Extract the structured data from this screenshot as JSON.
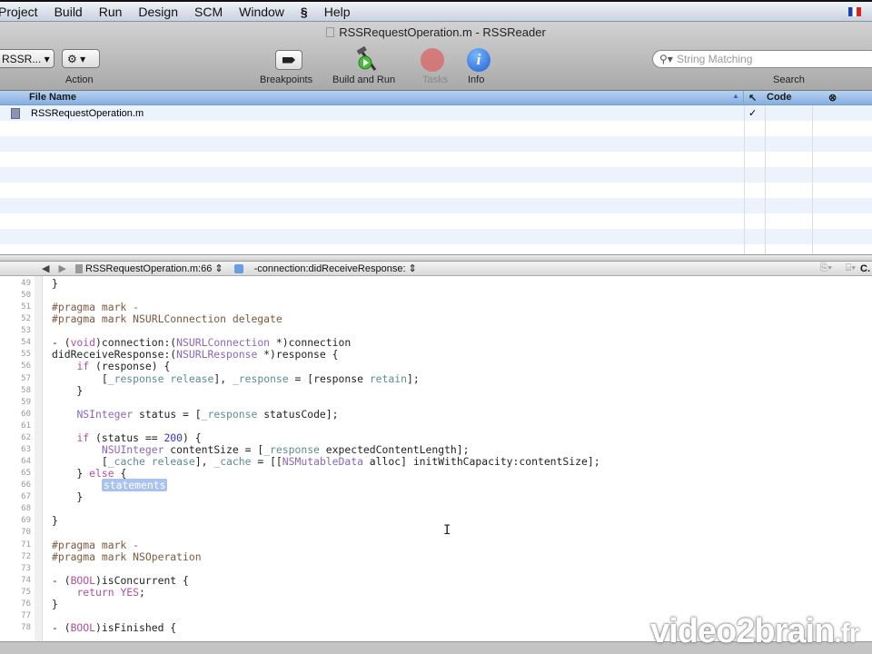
{
  "menu": [
    "Project",
    "Build",
    "Run",
    "Design",
    "SCM",
    "Window",
    "Help"
  ],
  "window_title": "RSSRequestOperation.m - RSSReader",
  "toolbar": {
    "overview_popup": "RSSR...",
    "action_label": "Action",
    "breakpoints_label": "Breakpoints",
    "build_run_label": "Build and Run",
    "tasks_label": "Tasks",
    "info_label": "Info",
    "search_placeholder": "String Matching",
    "search_label": "Search"
  },
  "file_list": {
    "headers": {
      "name": "File Name",
      "code": "Code"
    },
    "rows": [
      {
        "name": "RSSRequestOperation.m",
        "check": "✓"
      }
    ]
  },
  "editor_nav": {
    "file": "RSSRequestOperation.m:66",
    "function": "-connection:didReceiveResponse:"
  },
  "code": {
    "first_line": 49,
    "lines": [
      [
        [
          "}",
          ""
        ]
      ],
      [],
      [
        [
          "#pragma mark -",
          "pp"
        ]
      ],
      [
        [
          "#pragma mark NSURLConnection delegate",
          "pp"
        ]
      ],
      [],
      [
        [
          "- (",
          ""
        ],
        [
          "void",
          "kw"
        ],
        [
          ")connection:(",
          ""
        ],
        [
          "NSURLConnection",
          "ty"
        ],
        [
          " *)connection",
          ""
        ]
      ],
      [
        [
          "didReceiveResponse:(",
          ""
        ],
        [
          "NSURLResponse",
          "ty"
        ],
        [
          " *)response {",
          ""
        ]
      ],
      [
        [
          "    ",
          ""
        ],
        [
          "if",
          "kw"
        ],
        [
          " (response) {",
          ""
        ]
      ],
      [
        [
          "        [",
          ""
        ],
        [
          "_response",
          "iv"
        ],
        [
          " ",
          ""
        ],
        [
          "release",
          "iv"
        ],
        [
          "], ",
          ""
        ],
        [
          "_response",
          "iv"
        ],
        [
          " = [response ",
          ""
        ],
        [
          "retain",
          "iv"
        ],
        [
          "];",
          ""
        ]
      ],
      [
        [
          "    }",
          ""
        ]
      ],
      [],
      [
        [
          "    ",
          ""
        ],
        [
          "NSInteger",
          "ty"
        ],
        [
          " status = [",
          ""
        ],
        [
          "_response",
          "iv"
        ],
        [
          " statusCode];",
          ""
        ]
      ],
      [],
      [
        [
          "    ",
          ""
        ],
        [
          "if",
          "kw"
        ],
        [
          " (status == ",
          ""
        ],
        [
          "200",
          "nm"
        ],
        [
          ") {",
          ""
        ]
      ],
      [
        [
          "        ",
          ""
        ],
        [
          "NSUInteger",
          "ty"
        ],
        [
          " contentSize = [",
          ""
        ],
        [
          "_response",
          "iv"
        ],
        [
          " expectedContentLength];",
          ""
        ]
      ],
      [
        [
          "        [",
          ""
        ],
        [
          "_cache",
          "iv"
        ],
        [
          " ",
          ""
        ],
        [
          "release",
          "iv"
        ],
        [
          "], ",
          ""
        ],
        [
          "_cache",
          "iv"
        ],
        [
          " = [[",
          ""
        ],
        [
          "NSMutableData",
          "ty"
        ],
        [
          " alloc] initWithCapacity:contentSize];",
          ""
        ]
      ],
      [
        [
          "    } ",
          ""
        ],
        [
          "else",
          "kw"
        ],
        [
          " {",
          ""
        ]
      ],
      [
        [
          "        ",
          ""
        ],
        [
          "statements",
          "sel"
        ]
      ],
      [
        [
          "    }",
          ""
        ]
      ],
      [],
      [
        [
          "}",
          ""
        ]
      ],
      [],
      [
        [
          "#pragma mark -",
          "pp"
        ]
      ],
      [
        [
          "#pragma mark NSOperation",
          "pp"
        ]
      ],
      [],
      [
        [
          "- (",
          ""
        ],
        [
          "BOOL",
          "kw"
        ],
        [
          ")isConcurrent {",
          ""
        ]
      ],
      [
        [
          "    ",
          ""
        ],
        [
          "return",
          "kw"
        ],
        [
          " ",
          ""
        ],
        [
          "YES",
          "kw"
        ],
        [
          ";",
          ""
        ]
      ],
      [
        [
          "}",
          ""
        ]
      ],
      [],
      [
        [
          "- (",
          ""
        ],
        [
          "BOOL",
          "kw"
        ],
        [
          ")isFinished {",
          ""
        ]
      ]
    ]
  },
  "watermark": {
    "brand": "video2brain",
    ".tld": ".fr"
  }
}
